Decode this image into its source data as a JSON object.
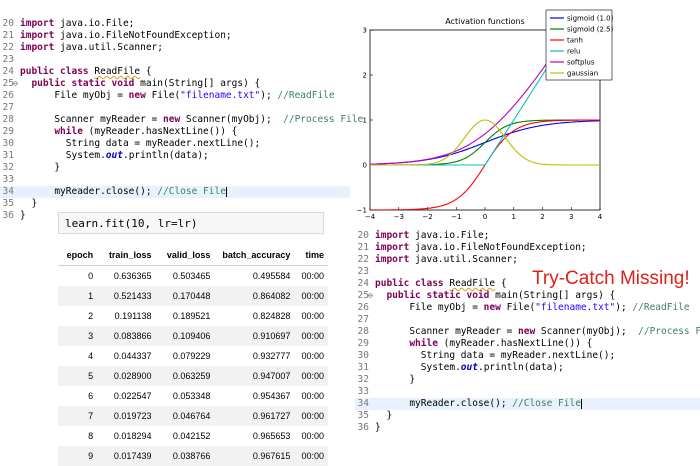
{
  "code_top": {
    "lines": [
      {
        "num": "20",
        "parts": [
          {
            "t": "import",
            "c": "kw"
          },
          {
            "t": " java.io.File;"
          }
        ]
      },
      {
        "num": "21",
        "parts": [
          {
            "t": "import",
            "c": "kw"
          },
          {
            "t": " java.io.FileNotFoundException;"
          }
        ]
      },
      {
        "num": "22",
        "parts": [
          {
            "t": "import",
            "c": "kw"
          },
          {
            "t": " java.util.Scanner;"
          }
        ]
      },
      {
        "num": "23",
        "parts": []
      },
      {
        "num": "24",
        "parts": [
          {
            "t": "public class",
            "c": "kw"
          },
          {
            "t": " "
          },
          {
            "t": "ReadFile",
            "c": "sq"
          },
          {
            "t": " {"
          }
        ]
      },
      {
        "num": "25",
        "mark": "⊖",
        "parts": [
          {
            "t": "  "
          },
          {
            "t": "public static void",
            "c": "kw"
          },
          {
            "t": " main(String[] args) {"
          }
        ]
      },
      {
        "num": "26",
        "parts": [
          {
            "t": "      File myObj = "
          },
          {
            "t": "new",
            "c": "kw"
          },
          {
            "t": " File("
          },
          {
            "t": "\"filename.txt\"",
            "c": "str"
          },
          {
            "t": "); "
          },
          {
            "t": "//ReadFile",
            "c": "cmt"
          }
        ]
      },
      {
        "num": "27",
        "parts": []
      },
      {
        "num": "28",
        "parts": [
          {
            "t": "      Scanner myReader = "
          },
          {
            "t": "new",
            "c": "kw"
          },
          {
            "t": " Scanner(myObj);  "
          },
          {
            "t": "//Process File",
            "c": "cmt"
          }
        ]
      },
      {
        "num": "29",
        "parts": [
          {
            "t": "      "
          },
          {
            "t": "while",
            "c": "kw"
          },
          {
            "t": " (myReader.hasNextLine()) {"
          }
        ]
      },
      {
        "num": "30",
        "parts": [
          {
            "t": "        String data = myReader.nextLine();"
          }
        ]
      },
      {
        "num": "31",
        "parts": [
          {
            "t": "        System."
          },
          {
            "t": "out",
            "c": "it"
          },
          {
            "t": ".println(data);"
          }
        ]
      },
      {
        "num": "32",
        "parts": [
          {
            "t": "      }"
          }
        ]
      },
      {
        "num": "33",
        "parts": []
      },
      {
        "num": "34",
        "hl": true,
        "caret": true,
        "parts": [
          {
            "t": "      myReader.close(); "
          },
          {
            "t": "//Close File",
            "c": "cmt"
          }
        ]
      },
      {
        "num": "35",
        "parts": [
          {
            "t": "  }"
          }
        ]
      },
      {
        "num": "36",
        "parts": [
          {
            "t": "}"
          }
        ]
      }
    ]
  },
  "code_bottom": {
    "lines": [
      {
        "num": "20",
        "parts": [
          {
            "t": "import",
            "c": "kw"
          },
          {
            "t": " java.io.File;"
          }
        ]
      },
      {
        "num": "21",
        "parts": [
          {
            "t": "import",
            "c": "kw"
          },
          {
            "t": " java.io.FileNotFoundException;"
          }
        ]
      },
      {
        "num": "22",
        "parts": [
          {
            "t": "import",
            "c": "kw"
          },
          {
            "t": " java.util.Scanner;"
          }
        ]
      },
      {
        "num": "23",
        "parts": []
      },
      {
        "num": "24",
        "parts": [
          {
            "t": "public class",
            "c": "kw"
          },
          {
            "t": " "
          },
          {
            "t": "ReadFile",
            "c": "sq"
          },
          {
            "t": " {"
          }
        ]
      },
      {
        "num": "25",
        "mark": "⊖",
        "parts": [
          {
            "t": "  "
          },
          {
            "t": "public static void",
            "c": "kw"
          },
          {
            "t": " main(String[] args) {"
          }
        ]
      },
      {
        "num": "26",
        "parts": [
          {
            "t": "      File myObj = "
          },
          {
            "t": "new",
            "c": "kw"
          },
          {
            "t": " File("
          },
          {
            "t": "\"filename.txt\"",
            "c": "str"
          },
          {
            "t": "); "
          },
          {
            "t": "//ReadFile",
            "c": "cmt"
          }
        ]
      },
      {
        "num": "27",
        "parts": []
      },
      {
        "num": "28",
        "parts": [
          {
            "t": "      Scanner myReader = "
          },
          {
            "t": "new",
            "c": "kw"
          },
          {
            "t": " Scanner(myObj);  "
          },
          {
            "t": "//Process File",
            "c": "cmt"
          }
        ]
      },
      {
        "num": "29",
        "parts": [
          {
            "t": "      "
          },
          {
            "t": "while",
            "c": "kw"
          },
          {
            "t": " (myReader.hasNextLine()) {"
          }
        ]
      },
      {
        "num": "30",
        "parts": [
          {
            "t": "        String data = myReader.nextLine();"
          }
        ]
      },
      {
        "num": "31",
        "parts": [
          {
            "t": "        System."
          },
          {
            "t": "out",
            "c": "it"
          },
          {
            "t": ".println(data);"
          }
        ]
      },
      {
        "num": "32",
        "parts": [
          {
            "t": "      }"
          }
        ]
      },
      {
        "num": "33",
        "parts": []
      },
      {
        "num": "34",
        "hl": true,
        "caret": true,
        "parts": [
          {
            "t": "      myReader.close(); "
          },
          {
            "t": "//Close File",
            "c": "cmt"
          }
        ]
      },
      {
        "num": "35",
        "parts": [
          {
            "t": "  }"
          }
        ]
      },
      {
        "num": "36",
        "parts": [
          {
            "t": "}"
          }
        ]
      }
    ]
  },
  "notebook": {
    "cell_code": "learn.fit(10, lr=lr)",
    "columns": [
      "epoch",
      "train_loss",
      "valid_loss",
      "batch_accuracy",
      "time"
    ],
    "rows": [
      [
        "0",
        "0.636365",
        "0.503465",
        "0.495584",
        "00:00"
      ],
      [
        "1",
        "0.521433",
        "0.170448",
        "0.864082",
        "00:00"
      ],
      [
        "2",
        "0.191138",
        "0.189521",
        "0.824828",
        "00:00"
      ],
      [
        "3",
        "0.083866",
        "0.109406",
        "0.910697",
        "00:00"
      ],
      [
        "4",
        "0.044337",
        "0.079229",
        "0.932777",
        "00:00"
      ],
      [
        "5",
        "0.028900",
        "0.063259",
        "0.947007",
        "00:00"
      ],
      [
        "6",
        "0.022547",
        "0.053348",
        "0.954367",
        "00:00"
      ],
      [
        "7",
        "0.019723",
        "0.046764",
        "0.961727",
        "00:00"
      ],
      [
        "8",
        "0.018294",
        "0.042152",
        "0.965653",
        "00:00"
      ],
      [
        "9",
        "0.017439",
        "0.038766",
        "0.967615",
        "00:00"
      ]
    ]
  },
  "annotation": "Try-Catch Missing!",
  "chart_data": {
    "type": "line",
    "title": "Activation functions",
    "xlim": [
      -4,
      4
    ],
    "ylim": [
      -1,
      3
    ],
    "xticks": [
      "−4",
      "−3",
      "−2",
      "−1",
      "0",
      "1",
      "2",
      "3",
      "4"
    ],
    "yticks": [
      "−1",
      "0",
      "1",
      "2",
      "3"
    ],
    "legend_position": "top-right",
    "series": [
      {
        "name": "sigmoid (1.0)",
        "color": "#0000ff",
        "func": "sigmoid",
        "k": 1.0
      },
      {
        "name": "sigmoid (2.5)",
        "color": "#008000",
        "func": "sigmoid",
        "k": 2.5
      },
      {
        "name": "tanh",
        "color": "#ff0000",
        "func": "tanh"
      },
      {
        "name": "relu",
        "color": "#00bfbf",
        "func": "relu"
      },
      {
        "name": "softplus",
        "color": "#bf00bf",
        "func": "softplus"
      },
      {
        "name": "gaussian",
        "color": "#bfbf00",
        "func": "gaussian"
      }
    ]
  }
}
